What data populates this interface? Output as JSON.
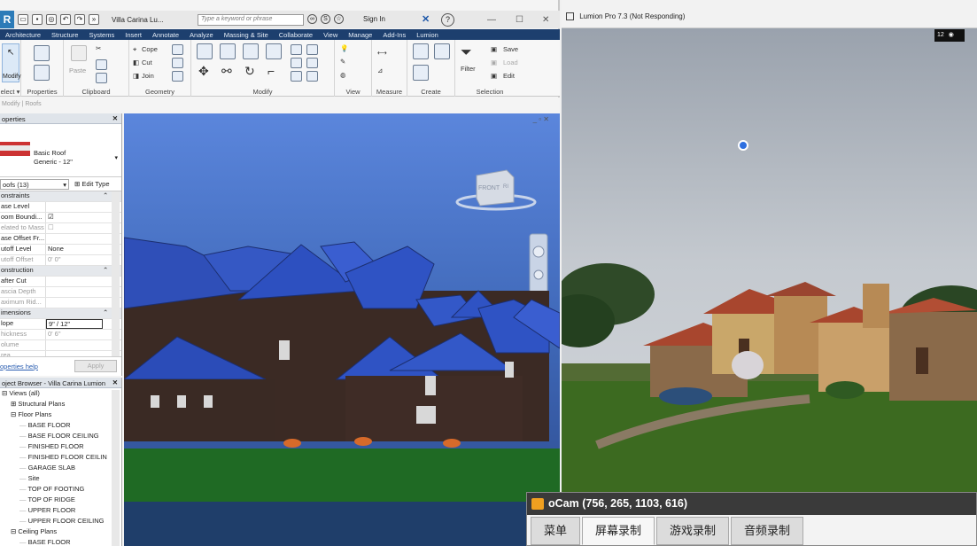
{
  "revit": {
    "title": "Villa Carina Lu...",
    "search_placeholder": "Type a keyword or phrase",
    "sign_in": "Sign In",
    "tabs": [
      "Architecture",
      "Structure",
      "Systems",
      "Insert",
      "Annotate",
      "Analyze",
      "Massing & Site",
      "Collaborate",
      "View",
      "Manage",
      "Add-Ins",
      "Lumion"
    ],
    "ribbon": {
      "modify_label": "Modify",
      "select_label": "elect ▾",
      "properties_label": "Properties",
      "clipboard_label": "Clipboard",
      "geometry_label": "Geometry",
      "modify_panel_label": "Modify",
      "view_label": "View",
      "measure_label": "Measure",
      "create_label": "Create",
      "selection_label": "Selection",
      "paste": "Paste",
      "cope": "Cope",
      "cut": "Cut",
      "join": "Join",
      "filter": "Filter",
      "save": "Save",
      "load": "Load",
      "edit": "Edit"
    },
    "status_text": "Modify | Roofs",
    "properties": {
      "header": "operties",
      "type_name": "Basic Roof",
      "type_sub": "Generic - 12\"",
      "filter": "oofs (13)",
      "edit_type": "Edit Type",
      "rows": [
        {
          "k": "onstraints",
          "v": "",
          "type": "section"
        },
        {
          "k": "ase Level",
          "v": "",
          "type": "normal"
        },
        {
          "k": "oom Boundi...",
          "v": "☑",
          "type": "normal"
        },
        {
          "k": "elated to Mass",
          "v": "☐",
          "type": "gray"
        },
        {
          "k": "ase Offset Fr...",
          "v": "",
          "type": "normal"
        },
        {
          "k": "utoff Level",
          "v": "None",
          "type": "normal"
        },
        {
          "k": "utoff Offset",
          "v": "0'  0\"",
          "type": "gray"
        },
        {
          "k": "onstruction",
          "v": "",
          "type": "section"
        },
        {
          "k": "after Cut",
          "v": "",
          "type": "normal"
        },
        {
          "k": "ascia Depth",
          "v": "",
          "type": "gray"
        },
        {
          "k": "aximum Rid...",
          "v": "",
          "type": "gray"
        },
        {
          "k": "imensions",
          "v": "",
          "type": "section"
        },
        {
          "k": "lope",
          "v": "9\" / 12\"",
          "type": "hl"
        },
        {
          "k": "hickness",
          "v": "0'  6\"",
          "type": "gray"
        },
        {
          "k": "olume",
          "v": "",
          "type": "gray"
        },
        {
          "k": "rea",
          "v": "",
          "type": "gray"
        }
      ],
      "help": "operties help",
      "apply": "Apply"
    },
    "browser": {
      "header": "oject Browser - Villa Carina Lumion",
      "items": [
        {
          "label": "Views (all)",
          "indent": 0,
          "sign": "⊟"
        },
        {
          "label": "Structural Plans",
          "indent": 1,
          "sign": "⊞"
        },
        {
          "label": "Floor Plans",
          "indent": 1,
          "sign": "⊟"
        },
        {
          "label": "BASE FLOOR",
          "indent": 2,
          "sign": ""
        },
        {
          "label": "BASE FLOOR CEILING",
          "indent": 2,
          "sign": ""
        },
        {
          "label": "FINISHED FLOOR",
          "indent": 2,
          "sign": ""
        },
        {
          "label": "FINISHED FLOOR CEILIN",
          "indent": 2,
          "sign": ""
        },
        {
          "label": "GARAGE SLAB",
          "indent": 2,
          "sign": ""
        },
        {
          "label": "Site",
          "indent": 2,
          "sign": ""
        },
        {
          "label": "TOP OF FOOTING",
          "indent": 2,
          "sign": ""
        },
        {
          "label": "TOP OF RIDGE",
          "indent": 2,
          "sign": ""
        },
        {
          "label": "UPPER FLOOR",
          "indent": 2,
          "sign": ""
        },
        {
          "label": "UPPER FLOOR CEILING",
          "indent": 2,
          "sign": ""
        },
        {
          "label": "Ceiling Plans",
          "indent": 1,
          "sign": "⊟"
        },
        {
          "label": "BASE FLOOR",
          "indent": 2,
          "sign": ""
        }
      ]
    },
    "viewcube": {
      "front": "FRONT",
      "right": "RI"
    }
  },
  "lumion": {
    "title": "Lumion Pro 7.3 (Not Responding)",
    "eye_count": "12"
  },
  "ocam": {
    "title": "oCam (756, 265, 1103, 616)",
    "tabs": [
      "菜单",
      "屏幕录制",
      "游戏录制",
      "音频录制"
    ],
    "active_tab": 1
  }
}
